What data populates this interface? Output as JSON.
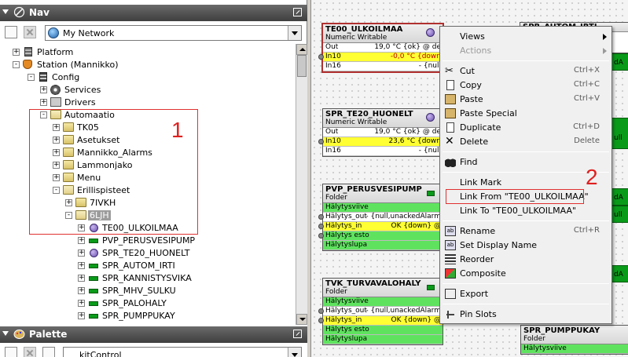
{
  "nav": {
    "title": "Nav",
    "network_combo": "My Network",
    "tree": [
      {
        "label": "Platform",
        "icon": "platform-icon",
        "exp": "+"
      },
      {
        "label": "Station (Mannikko)",
        "icon": "station-icon",
        "exp": "-"
      },
      {
        "label": "Config",
        "icon": "config-icon",
        "exp": "-"
      },
      {
        "label": "Services",
        "icon": "services-icon",
        "exp": "+"
      },
      {
        "label": "Drivers",
        "icon": "drivers-icon",
        "exp": "+"
      },
      {
        "label": "Automaatio",
        "icon": "folder-icon",
        "exp": "-"
      },
      {
        "label": "TK05",
        "icon": "folder-icon",
        "exp": "+"
      },
      {
        "label": "Asetukset",
        "icon": "folder-icon",
        "exp": "+"
      },
      {
        "label": "Mannikko_Alarms",
        "icon": "folder-icon",
        "exp": "+"
      },
      {
        "label": "Lammonjako",
        "icon": "folder-icon",
        "exp": "+"
      },
      {
        "label": "Menu",
        "icon": "folder-icon",
        "exp": "+"
      },
      {
        "label": "Erillispisteet",
        "icon": "folder-icon",
        "exp": "-"
      },
      {
        "label": "7IVKH",
        "icon": "folder-icon",
        "exp": "+"
      },
      {
        "label": "6LJH",
        "icon": "folder-icon",
        "exp": "-"
      },
      {
        "label": "TE00_ULKOILMAA",
        "icon": "numeric-writable-icon",
        "exp": "+"
      },
      {
        "label": "PVP_PERUSVESIPUMP",
        "icon": "boolean-point-icon",
        "exp": "+"
      },
      {
        "label": "SPR_TE20_HUONELT",
        "icon": "numeric-writable-icon",
        "exp": "+"
      },
      {
        "label": "SPR_AUTOM_IRTI",
        "icon": "boolean-point-icon",
        "exp": "+"
      },
      {
        "label": "SPR_KANNISTYSVIKA",
        "icon": "boolean-point-icon",
        "exp": "+"
      },
      {
        "label": "SPR_MHV_SULKU",
        "icon": "boolean-point-icon",
        "exp": "+"
      },
      {
        "label": "SPR_PALOHALY",
        "icon": "boolean-point-icon",
        "exp": "+"
      },
      {
        "label": "SPR_PUMPPUKAY",
        "icon": "boolean-point-icon",
        "exp": "+"
      }
    ],
    "annotation_1": "1"
  },
  "palette": {
    "title": "Palette",
    "combo": "kitControl"
  },
  "wiresheet": {
    "blocks": [
      {
        "name": "TE00_ULKOILMAA",
        "type": "Numeric Writable",
        "slots": [
          {
            "name": "Out",
            "value": "19,0 °C {ok} @ de",
            "style": "white"
          },
          {
            "name": "In10",
            "value": "-0,0 °C {down",
            "style": "yellow"
          },
          {
            "name": "In16",
            "value": "- {null",
            "style": "white"
          }
        ]
      },
      {
        "name": "SPR_TE20_HUONELT",
        "type": "Numeric Writable",
        "slots": [
          {
            "name": "Out",
            "value": "19,0 °C {ok} @ de",
            "style": "white"
          },
          {
            "name": "In10",
            "value": "23,6 °C {down",
            "style": "yellow"
          },
          {
            "name": "In16",
            "value": "- {null",
            "style": "white"
          }
        ]
      },
      {
        "name": "PVP_PERUSVESIPUMP",
        "type": "Folder",
        "slots": [
          {
            "name": "Hälytysviive",
            "value": "",
            "style": "green"
          },
          {
            "name": "Hälytys_out",
            "value": "- {null,unackedAlarm",
            "style": "white"
          },
          {
            "name": "Hälytys_in",
            "value": "OK {down} @",
            "style": "yellow"
          },
          {
            "name": "Hälytys esto",
            "value": "",
            "style": "green"
          },
          {
            "name": "Hälytyslupa",
            "value": "",
            "style": "green"
          }
        ]
      },
      {
        "name": "TVK_TURVAVALOHALY",
        "type": "Folder",
        "slots": [
          {
            "name": "Hälytysviive",
            "value": "",
            "style": "green"
          },
          {
            "name": "Hälytys_out",
            "value": "- {null,unackedAlarm",
            "style": "white"
          },
          {
            "name": "Hälytys_in",
            "value": "OK {down} @",
            "style": "yellow"
          },
          {
            "name": "Hälytys esto",
            "value": "",
            "style": "green"
          },
          {
            "name": "Hälytyslupa",
            "value": "",
            "style": "green"
          }
        ]
      },
      {
        "name": "SPR_PUMPPUKAY",
        "type": "Folder",
        "slots": [
          {
            "name": "Hälytysviive",
            "value": "",
            "style": "green"
          }
        ]
      }
    ],
    "right_edge_fragments": {
      "top_partial_title": "SPR_AUTOM_IRTI",
      "r1": "dA",
      "r2": "ull",
      "r3": "dA",
      "r4": "ull",
      "r5": "dA"
    }
  },
  "context_menu": {
    "items": [
      {
        "label": "Views",
        "shortcut": "",
        "submenu": true,
        "disabled": false
      },
      {
        "label": "Actions",
        "shortcut": "",
        "submenu": true,
        "disabled": true
      },
      {
        "label": "Cut",
        "shortcut": "Ctrl+X",
        "disabled": false
      },
      {
        "label": "Copy",
        "shortcut": "Ctrl+C",
        "disabled": false
      },
      {
        "label": "Paste",
        "shortcut": "Ctrl+V",
        "disabled": false
      },
      {
        "label": "Paste Special",
        "shortcut": "",
        "disabled": false
      },
      {
        "label": "Duplicate",
        "shortcut": "Ctrl+D",
        "disabled": false
      },
      {
        "label": "Delete",
        "shortcut": "Delete",
        "disabled": false
      },
      {
        "label": "Find",
        "shortcut": "",
        "disabled": false
      },
      {
        "label": "Link Mark",
        "shortcut": "",
        "disabled": false
      },
      {
        "label": "Link From \"TE00_ULKOILMAA\"",
        "shortcut": "",
        "disabled": false
      },
      {
        "label": "Link To \"TE00_ULKOILMAA\"",
        "shortcut": "",
        "disabled": false
      },
      {
        "label": "Rename",
        "shortcut": "Ctrl+R",
        "disabled": false
      },
      {
        "label": "Set Display Name",
        "shortcut": "",
        "disabled": false
      },
      {
        "label": "Reorder",
        "shortcut": "",
        "disabled": false
      },
      {
        "label": "Composite",
        "shortcut": "",
        "disabled": false
      },
      {
        "label": "Export",
        "shortcut": "",
        "disabled": false
      },
      {
        "label": "Pin Slots",
        "shortcut": "",
        "disabled": false
      }
    ],
    "annotation_2": "2"
  },
  "colors": {
    "annotation_red": "#e02020",
    "slot_yellow": "#ffff33",
    "slot_green": "#5fe35f",
    "boolean_green": "#0a9a1a",
    "selection_gray": "#9c9c9c"
  }
}
